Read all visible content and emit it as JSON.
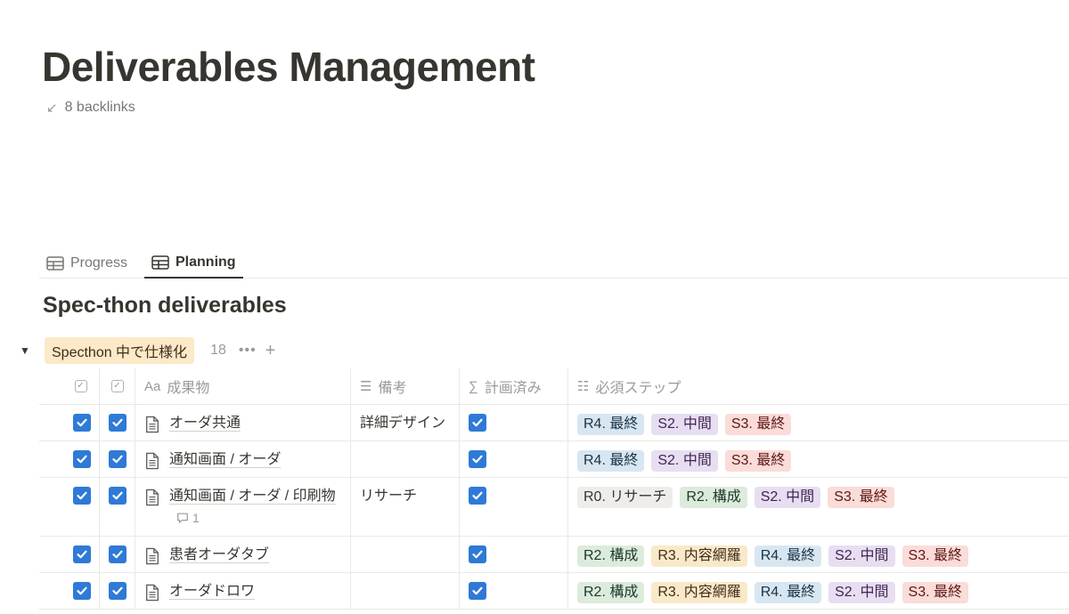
{
  "page": {
    "title": "Deliverables Management",
    "backlinks": "8 backlinks"
  },
  "tabs": [
    {
      "label": "Progress",
      "active": false
    },
    {
      "label": "Planning",
      "active": true
    }
  ],
  "database": {
    "title": "Spec-thon deliverables"
  },
  "group": {
    "label": "Specthon 中で仕様化",
    "count": "18",
    "more": "•••",
    "add": "+"
  },
  "columns": {
    "name": "成果物",
    "name_prefix": "Aa",
    "note": "備考",
    "planned": "計画済み",
    "steps": "必須ステップ"
  },
  "tag_colors": {
    "gray": "#eeedeb",
    "blue": "#d8e6f1",
    "purple": "#e7def2",
    "red": "#fadcd8",
    "green": "#dcebdc",
    "yellow": "#f9e9c8",
    "text_gray": "#37352f",
    "text_blue": "#183347",
    "text_purple": "#412454",
    "text_red": "#5d1715",
    "text_green": "#1c3829",
    "text_yellow": "#402c1b"
  },
  "accent": "#2e7ad6",
  "rows": [
    {
      "name": "オーダ共通",
      "note": "詳細デザイン",
      "comment": "",
      "tags": [
        {
          "label": "R4. 最終",
          "color": "blue"
        },
        {
          "label": "S2. 中間",
          "color": "purple"
        },
        {
          "label": "S3. 最終",
          "color": "red"
        }
      ]
    },
    {
      "name": "通知画面 / オーダ",
      "note": "",
      "comment": "",
      "tags": [
        {
          "label": "R4. 最終",
          "color": "blue"
        },
        {
          "label": "S2. 中間",
          "color": "purple"
        },
        {
          "label": "S3. 最終",
          "color": "red"
        }
      ]
    },
    {
      "name": "通知画面 / オーダ / 印刷物",
      "note": "リサーチ",
      "comment": "1",
      "tags": [
        {
          "label": "R0. リサーチ",
          "color": "gray"
        },
        {
          "label": "R2. 構成",
          "color": "green"
        },
        {
          "label": "S2. 中間",
          "color": "purple"
        },
        {
          "label": "S3. 最終",
          "color": "red"
        }
      ]
    },
    {
      "name": "患者オーダタブ",
      "note": "",
      "comment": "",
      "tags": [
        {
          "label": "R2. 構成",
          "color": "green"
        },
        {
          "label": "R3. 内容網羅",
          "color": "yellow"
        },
        {
          "label": "R4. 最終",
          "color": "blue"
        },
        {
          "label": "S2. 中間",
          "color": "purple"
        },
        {
          "label": "S3. 最終",
          "color": "red"
        }
      ]
    },
    {
      "name": "オーダドロワ",
      "note": "",
      "comment": "",
      "tags": [
        {
          "label": "R2. 構成",
          "color": "green"
        },
        {
          "label": "R3. 内容網羅",
          "color": "yellow"
        },
        {
          "label": "R4. 最終",
          "color": "blue"
        },
        {
          "label": "S2. 中間",
          "color": "purple"
        },
        {
          "label": "S3. 最終",
          "color": "red"
        }
      ]
    }
  ]
}
